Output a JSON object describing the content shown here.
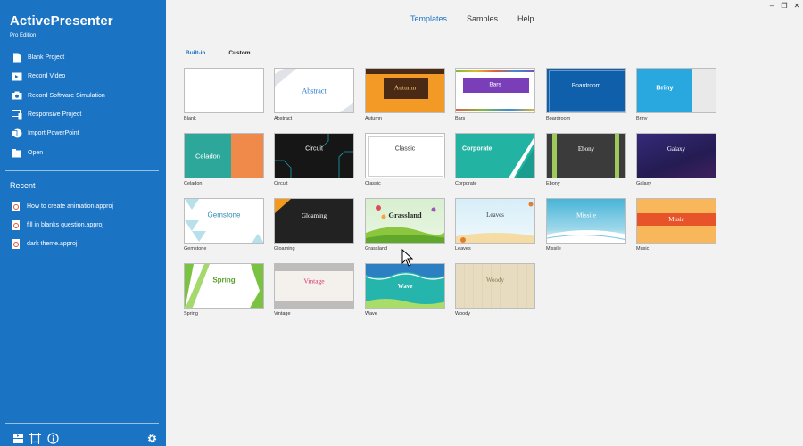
{
  "app": {
    "title": "ActivePresenter",
    "edition": "Pro Edition"
  },
  "sidebar": {
    "actions": [
      {
        "label": "Blank Project",
        "icon": "blank-project-icon"
      },
      {
        "label": "Record Video",
        "icon": "record-video-icon"
      },
      {
        "label": "Record Software Simulation",
        "icon": "camera-icon"
      },
      {
        "label": "Responsive Project",
        "icon": "responsive-icon"
      },
      {
        "label": "Import PowerPoint",
        "icon": "powerpoint-icon"
      },
      {
        "label": "Open",
        "icon": "folder-icon"
      }
    ],
    "recent_title": "Recent",
    "recent": [
      "How to create animation.approj",
      "fill in blanks question.approj",
      "dark theme.approj"
    ]
  },
  "top_tabs": [
    "Templates",
    "Samples",
    "Help"
  ],
  "active_top_tab": "Templates",
  "sub_tabs": [
    "Built-in",
    "Custom"
  ],
  "active_sub_tab": "Built-in",
  "templates": [
    {
      "name": "Blank",
      "title": ""
    },
    {
      "name": "Abstract",
      "title": "Abstract"
    },
    {
      "name": "Autumn",
      "title": "Autumn"
    },
    {
      "name": "Bars",
      "title": "Bars"
    },
    {
      "name": "Boardroom",
      "title": "Boardroom"
    },
    {
      "name": "Briny",
      "title": "Briny"
    },
    {
      "name": "Celadon",
      "title": "Celadon"
    },
    {
      "name": "Circuit",
      "title": "Circuit"
    },
    {
      "name": "Classic",
      "title": "Classic"
    },
    {
      "name": "Corporate",
      "title": "Corporate"
    },
    {
      "name": "Ebony",
      "title": "Ebony"
    },
    {
      "name": "Galaxy",
      "title": "Galaxy"
    },
    {
      "name": "Gemstone",
      "title": "Gemstone"
    },
    {
      "name": "Gloaming",
      "title": "Gloaming"
    },
    {
      "name": "Grassland",
      "title": "Grassland"
    },
    {
      "name": "Leaves",
      "title": "Leaves"
    },
    {
      "name": "Missile",
      "title": "Missile"
    },
    {
      "name": "Music",
      "title": "Music"
    },
    {
      "name": "Spring",
      "title": "Spring"
    },
    {
      "name": "Vintage",
      "title": "Vintage"
    },
    {
      "name": "Wave",
      "title": "Wave"
    },
    {
      "name": "Woody",
      "title": "Woody"
    }
  ],
  "colors": {
    "sidebar": "#1b73c4",
    "accent": "#1b73c4",
    "background": "#f2f2f2"
  }
}
